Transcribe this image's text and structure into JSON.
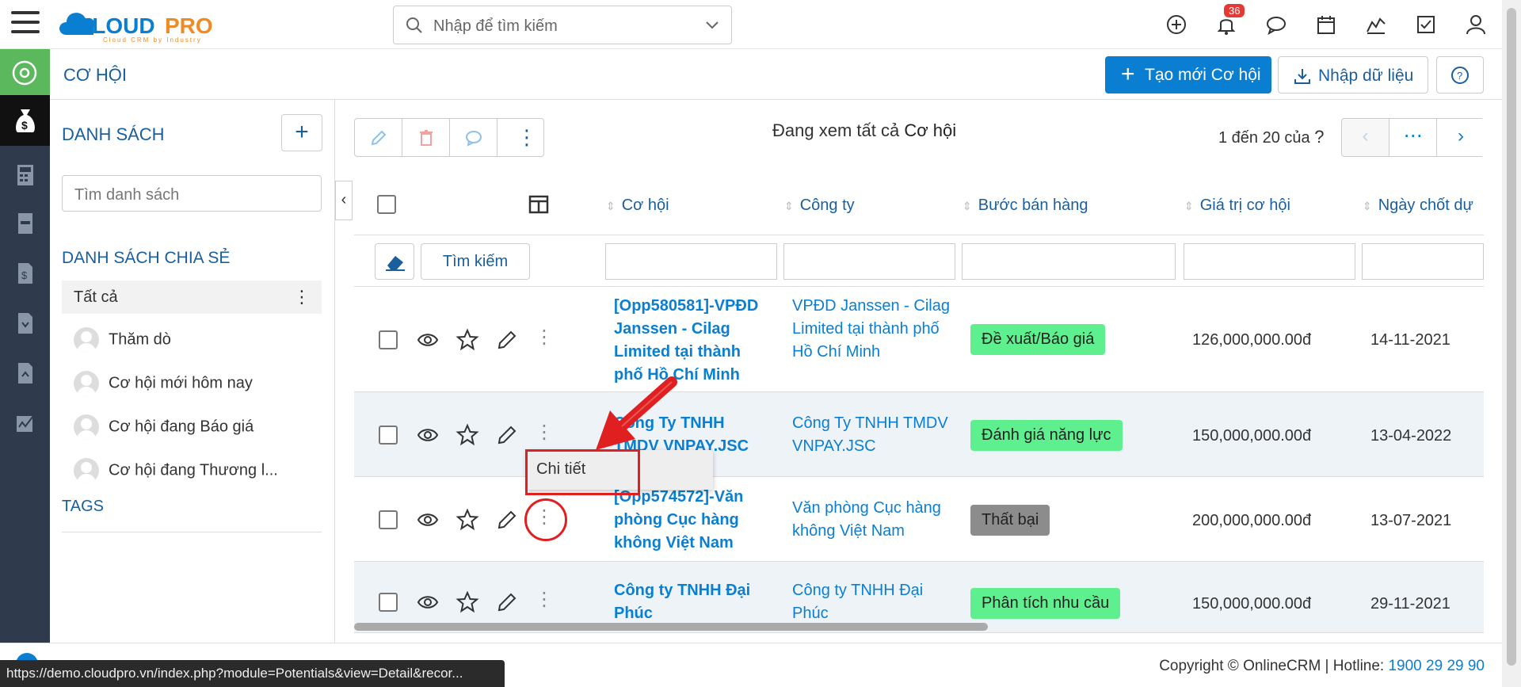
{
  "app": {
    "logo_text": "CLOUDPRO",
    "logo_tagline": "Cloud CRM by Industry",
    "search_placeholder": "Nhập để tìm kiếm",
    "notification_count": "36"
  },
  "module": {
    "title": "CƠ HỘI",
    "create_label": "Tạo mới Cơ hội",
    "import_label": "Nhập dữ liệu"
  },
  "sidebar": {
    "list_heading": "DANH SÁCH",
    "search_placeholder": "Tìm danh sách",
    "shared_heading": "DANH SÁCH CHIA SẺ",
    "all_label": "Tất cả",
    "items": [
      {
        "label": "Thăm dò"
      },
      {
        "label": "Cơ hội mới hôm nay"
      },
      {
        "label": "Cơ hội đang Báo giá"
      },
      {
        "label": "Cơ hội đang Thương l..."
      }
    ],
    "tags_heading": "TAGS"
  },
  "main": {
    "viewing_prefix": "Đang xem tất cả",
    "viewing_module": "Cơ hội",
    "page_info": "1 đến 20 của",
    "page_info_q": "?",
    "search_button": "Tìm kiếm",
    "columns": [
      "Cơ hội",
      "Công ty",
      "Bước bán hàng",
      "Giá trị cơ hội",
      "Ngày chốt dự"
    ],
    "rows": [
      {
        "opportunity": "[Opp580581]-VPĐD Janssen - Cilag Limited tại thành phố Hồ Chí Minh",
        "company": "VPĐD Janssen - Cilag Limited tại thành phố Hồ Chí Minh",
        "stage": "Đề xuất/Báo giá",
        "stage_color": "#5ef08f",
        "value": "126,000,000.00đ",
        "date": "14-11-2021"
      },
      {
        "opportunity": "Công Ty TNHH TMDV VNPAY.JSC",
        "company": "Công Ty TNHH TMDV VNPAY.JSC",
        "stage": "Đánh giá năng lực",
        "stage_color": "#5ef08f",
        "value": "150,000,000.00đ",
        "date": "13-04-2022"
      },
      {
        "opportunity": "[Opp574572]-Văn phòng Cục hàng không Việt Nam",
        "company": "Văn phòng Cục hàng không Việt Nam",
        "stage": "Thất bại",
        "stage_color": "#8c8c8c",
        "value": "200,000,000.00đ",
        "date": "13-07-2021"
      },
      {
        "opportunity": "Công ty TNHH Đại Phúc",
        "company": "Công ty TNHH Đại Phúc",
        "stage": "Phân tích nhu cầu",
        "stage_color": "#5ef08f",
        "value": "150,000,000.00đ",
        "date": "29-11-2021"
      }
    ],
    "context_menu_item": "Chi tiết"
  },
  "footer": {
    "copyright": "Copyright © OnlineCRM",
    "hotline_label": "Hotline:",
    "hotline": "1900 29 29 90",
    "status_url": "https://demo.cloudpro.vn/index.php?module=Potentials&view=Detail&recor..."
  },
  "colors": {
    "primary": "#0a7fd1",
    "rail": "#2f3b4c",
    "rail_green": "#5cb85c",
    "annotation": "#e02020"
  }
}
